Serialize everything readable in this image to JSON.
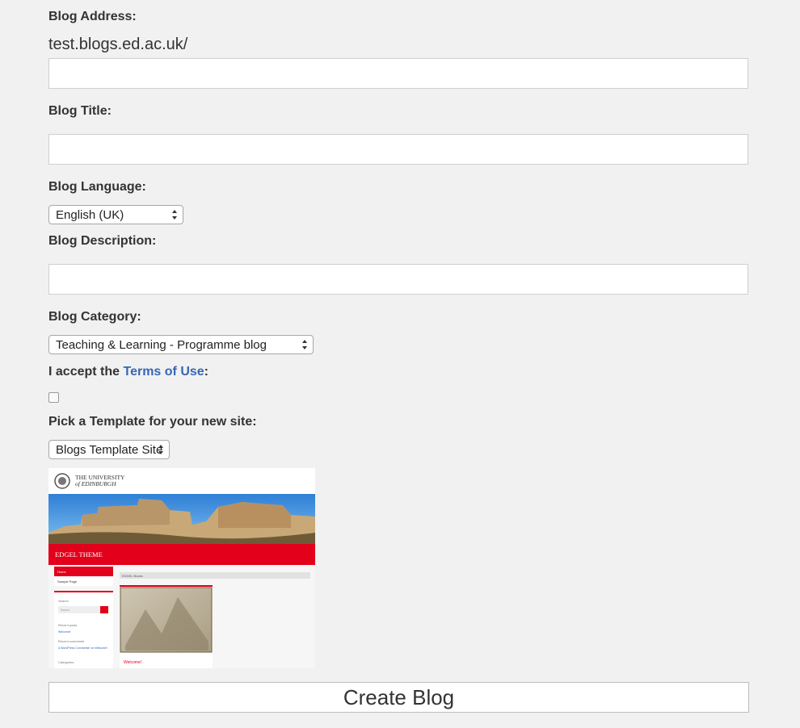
{
  "form": {
    "blog_address": {
      "label": "Blog Address:",
      "domain": "test.blogs.ed.ac.uk/",
      "value": ""
    },
    "blog_title": {
      "label": "Blog Title:",
      "value": ""
    },
    "blog_language": {
      "label": "Blog Language:",
      "selected": "English (UK)"
    },
    "blog_description": {
      "label": "Blog Description:",
      "value": ""
    },
    "blog_category": {
      "label": "Blog Category:",
      "selected": "Teaching & Learning - Programme blog"
    },
    "terms": {
      "prefix": "I accept the ",
      "link": "Terms of Use",
      "suffix": ":",
      "checked": false
    },
    "template": {
      "label": "Pick a Template for your new site:",
      "selected": "Blogs Template Site"
    },
    "submit_label": "Create Blog"
  },
  "template_preview": {
    "university_line1": "THE UNIVERSITY",
    "university_line2": "of EDINBURGH",
    "theme_name": "EDGEL THEME",
    "menu": [
      "Home",
      "Sample Page"
    ],
    "breadcrumb": "EDGEL Books",
    "search_label": "Search",
    "search_placeholder": "Search",
    "recent_posts_label": "Recent posts",
    "recent_posts_item": "Welcome!",
    "recent_comments_label": "Recent comments",
    "recent_comments_item": "A WordPress Commenter on Welcome!",
    "categories_label": "Categories",
    "post_title": "Welcome!",
    "colors": {
      "brand_red": "#e2001a",
      "sky": "#3a8ee0",
      "link_blue": "#3567b4"
    }
  }
}
